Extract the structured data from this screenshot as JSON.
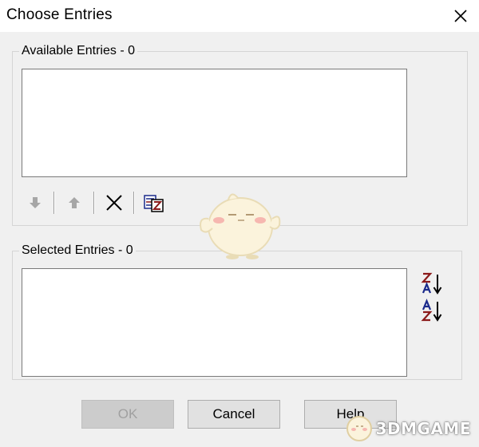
{
  "window": {
    "title": "Choose Entries"
  },
  "available": {
    "label": "Available Entries - 0",
    "items": []
  },
  "toolbar": {
    "icons": [
      "arrow-down-icon",
      "arrow-up-icon",
      "delete-x-icon",
      "sort-entries-icon"
    ]
  },
  "selected": {
    "label": "Selected Entries - 0",
    "items": [],
    "sort_icons": [
      "sort-z-a-icon",
      "sort-a-z-icon"
    ]
  },
  "buttons": {
    "ok": "OK",
    "cancel": "Cancel",
    "help": "Help"
  },
  "watermark": {
    "text": "3DMGAME"
  },
  "colors": {
    "accent_red": "#8b1a1a",
    "accent_blue": "#1a2a8b",
    "disabled_text": "#a0a0a0"
  }
}
